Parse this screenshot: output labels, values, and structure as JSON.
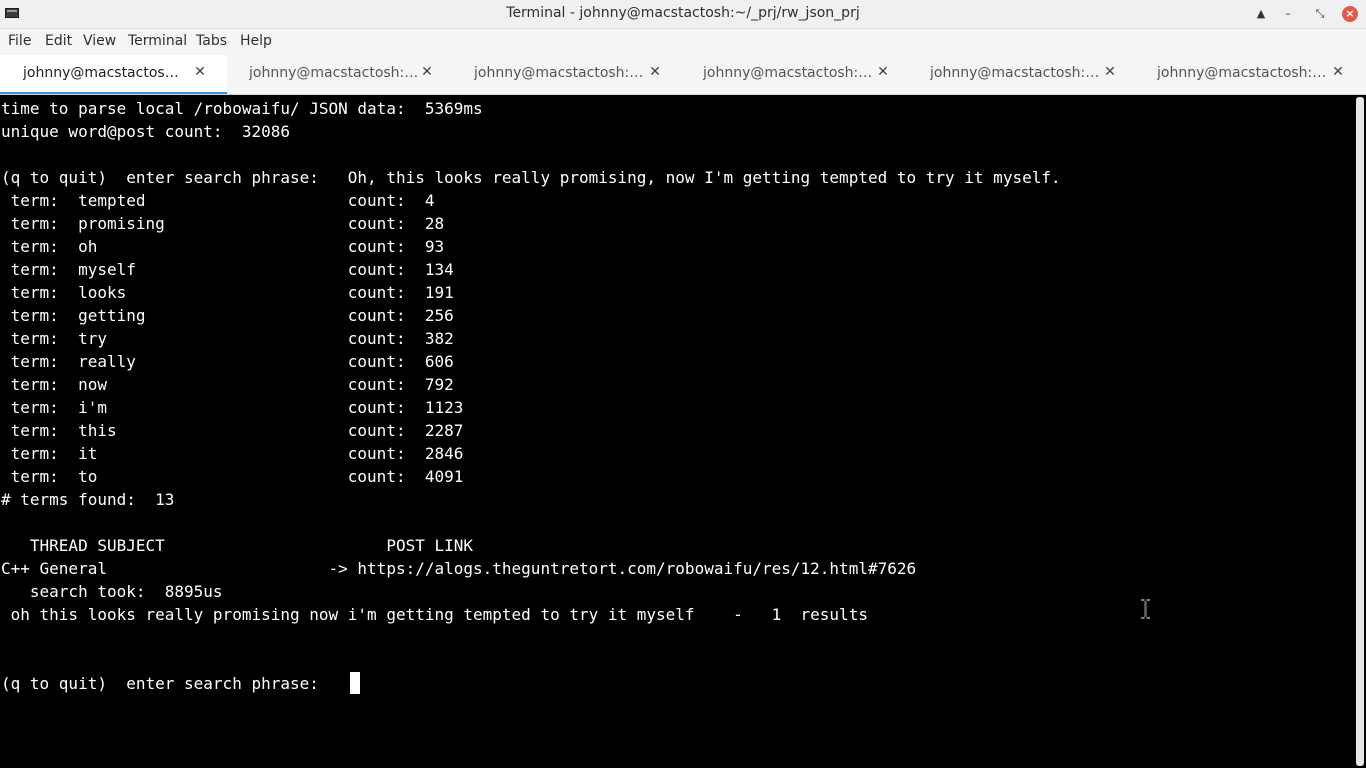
{
  "window": {
    "title": "Terminal - johnny@macstactosh:~/_prj/rw_json_prj"
  },
  "menu": [
    "File",
    "Edit",
    "View",
    "Terminal",
    "Tabs",
    "Help"
  ],
  "tabs": [
    {
      "label": "johnny@macstactosh:~/_...",
      "active": true
    },
    {
      "label": "johnny@macstactosh:~/_...",
      "active": false
    },
    {
      "label": "johnny@macstactosh:~/_p...",
      "active": false
    },
    {
      "label": "johnny@macstactosh:~/M...",
      "active": false
    },
    {
      "label": "johnny@macstactosh:~/M...",
      "active": false
    },
    {
      "label": "johnny@macstactosh:~/_p...",
      "active": false
    }
  ],
  "tab_close_glyph": "✕",
  "colors": {
    "terminal_bg": "#000000",
    "terminal_fg": "#ffffff",
    "active_tab_accent": "#3b8ed8",
    "close_button": "#e05a4a"
  },
  "terminal": {
    "lines": [
      "time to parse local /robowaifu/ JSON data:  5369ms",
      "unique word@post count:  32086",
      "",
      "(q to quit)  enter search phrase:   Oh, this looks really promising, now I'm getting tempted to try it myself.",
      " term:  tempted                     count:  4",
      " term:  promising                   count:  28",
      " term:  oh                          count:  93",
      " term:  myself                      count:  134",
      " term:  looks                       count:  191",
      " term:  getting                     count:  256",
      " term:  try                         count:  382",
      " term:  really                      count:  606",
      " term:  now                         count:  792",
      " term:  i'm                         count:  1123",
      " term:  this                        count:  2287",
      " term:  it                          count:  2846",
      " term:  to                          count:  4091",
      "# terms found:  13",
      "",
      "   THREAD SUBJECT                       POST LINK",
      "C++ General                       -> https://alogs.theguntretort.com/robowaifu/res/12.html#7626",
      "   search took:  8895us",
      " oh this looks really promising now i'm getting tempted to try it myself    -   1  results",
      "",
      "",
      "(q to quit)  enter search phrase:   "
    ]
  }
}
